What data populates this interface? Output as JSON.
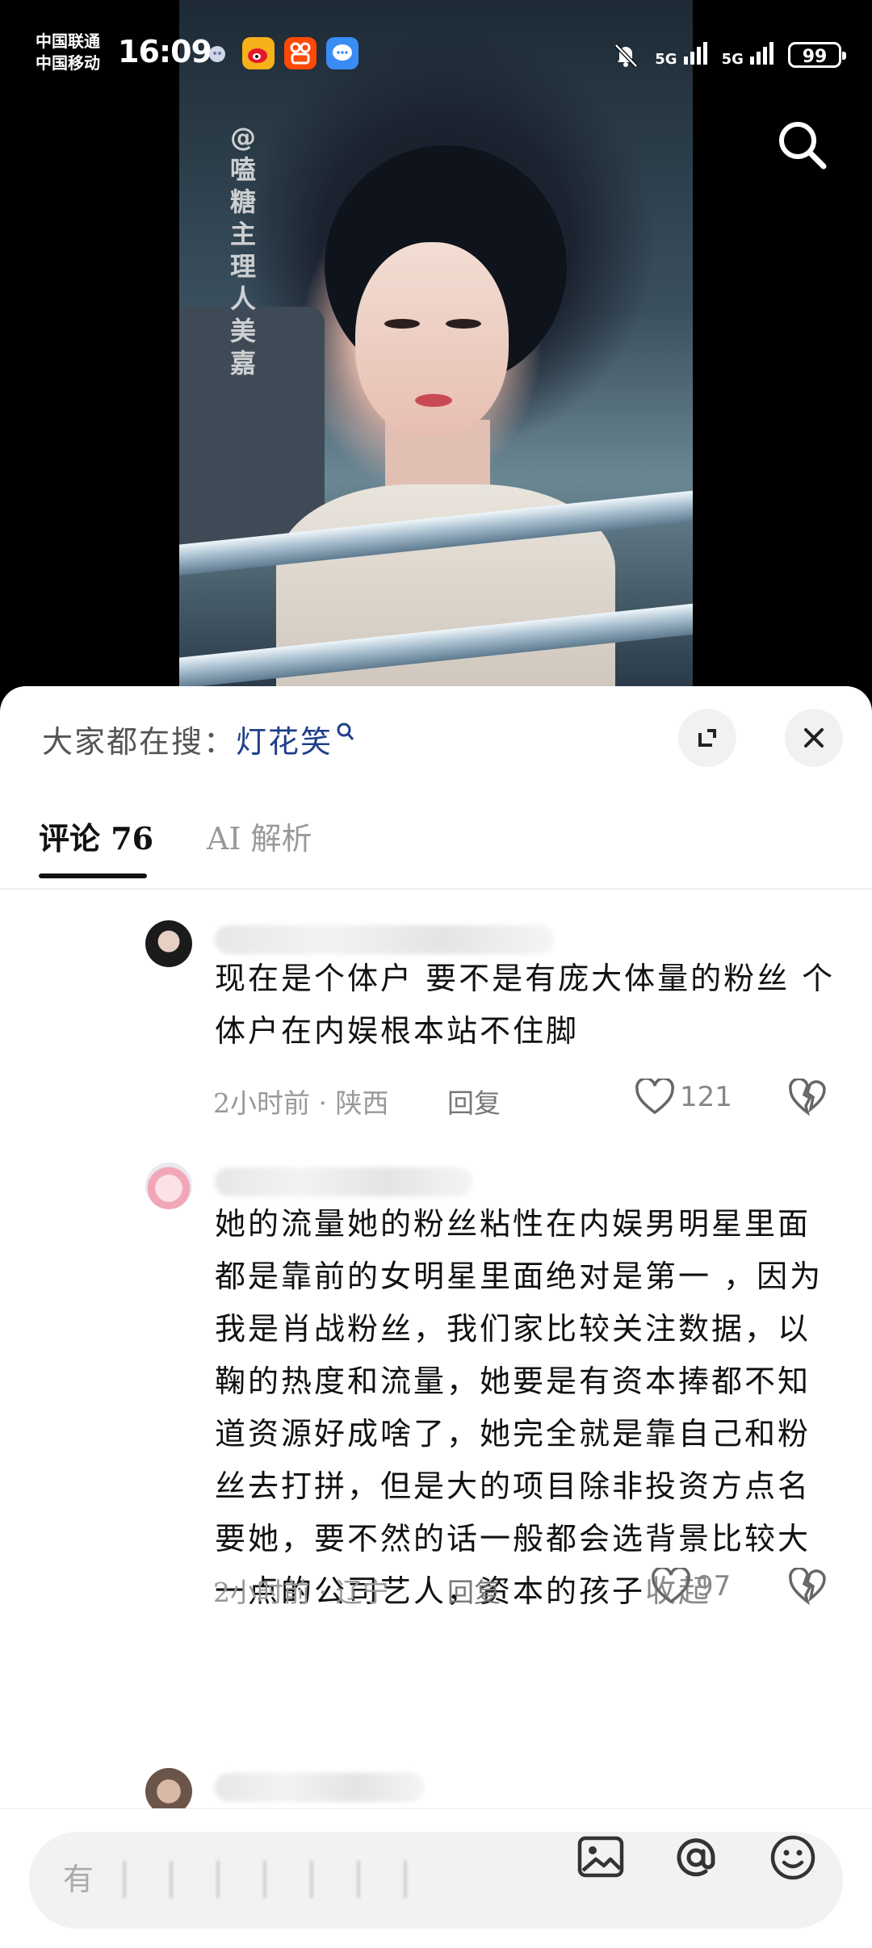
{
  "status_bar": {
    "carrier_1": "中国联通",
    "carrier_2": "中国移动",
    "time": "16:09",
    "app_icons": [
      "weibo-icon",
      "kuaishou-icon",
      "message-icon"
    ],
    "signal_1": "5G",
    "signal_2": "5G",
    "battery": "99"
  },
  "video": {
    "watermark": "@嗑糖主理人美嘉"
  },
  "sheet": {
    "trending_label": "大家都在搜：",
    "trending_keyword": "灯花笑",
    "tabs": [
      {
        "label": "评论 76",
        "active": true
      },
      {
        "label": "AI 解析",
        "active": false
      }
    ]
  },
  "comments": [
    {
      "text": "现在是个体户 要不是有庞大体量的粉丝 个体户在内娱根本站不住脚",
      "meta": "2小时前 · 陕西",
      "reply": "回复",
      "likes": "121"
    },
    {
      "text": "她的流量她的粉丝粘性在内娱男明星里面都是靠前的女明星里面绝对是第一 ，因为我是肖战粉丝，我们家比较关注数据，以鞠的热度和流量，她要是有资本捧都不知道资源好成啥了，她完全就是靠自己和粉丝去打拼，但是大的项目除非投资方点名要她，要不然的话一般都会选背景比较大一点的公司艺人，资本的孩子",
      "collapse": "收起",
      "meta": "2小时前 · 辽宁",
      "reply": "回复",
      "likes": "97"
    }
  ],
  "input": {
    "placeholder": "有"
  },
  "colors": {
    "keyword": "#1f3f8a",
    "text": "#111111",
    "muted": "#999999",
    "sheet_bg": "#ffffff"
  }
}
